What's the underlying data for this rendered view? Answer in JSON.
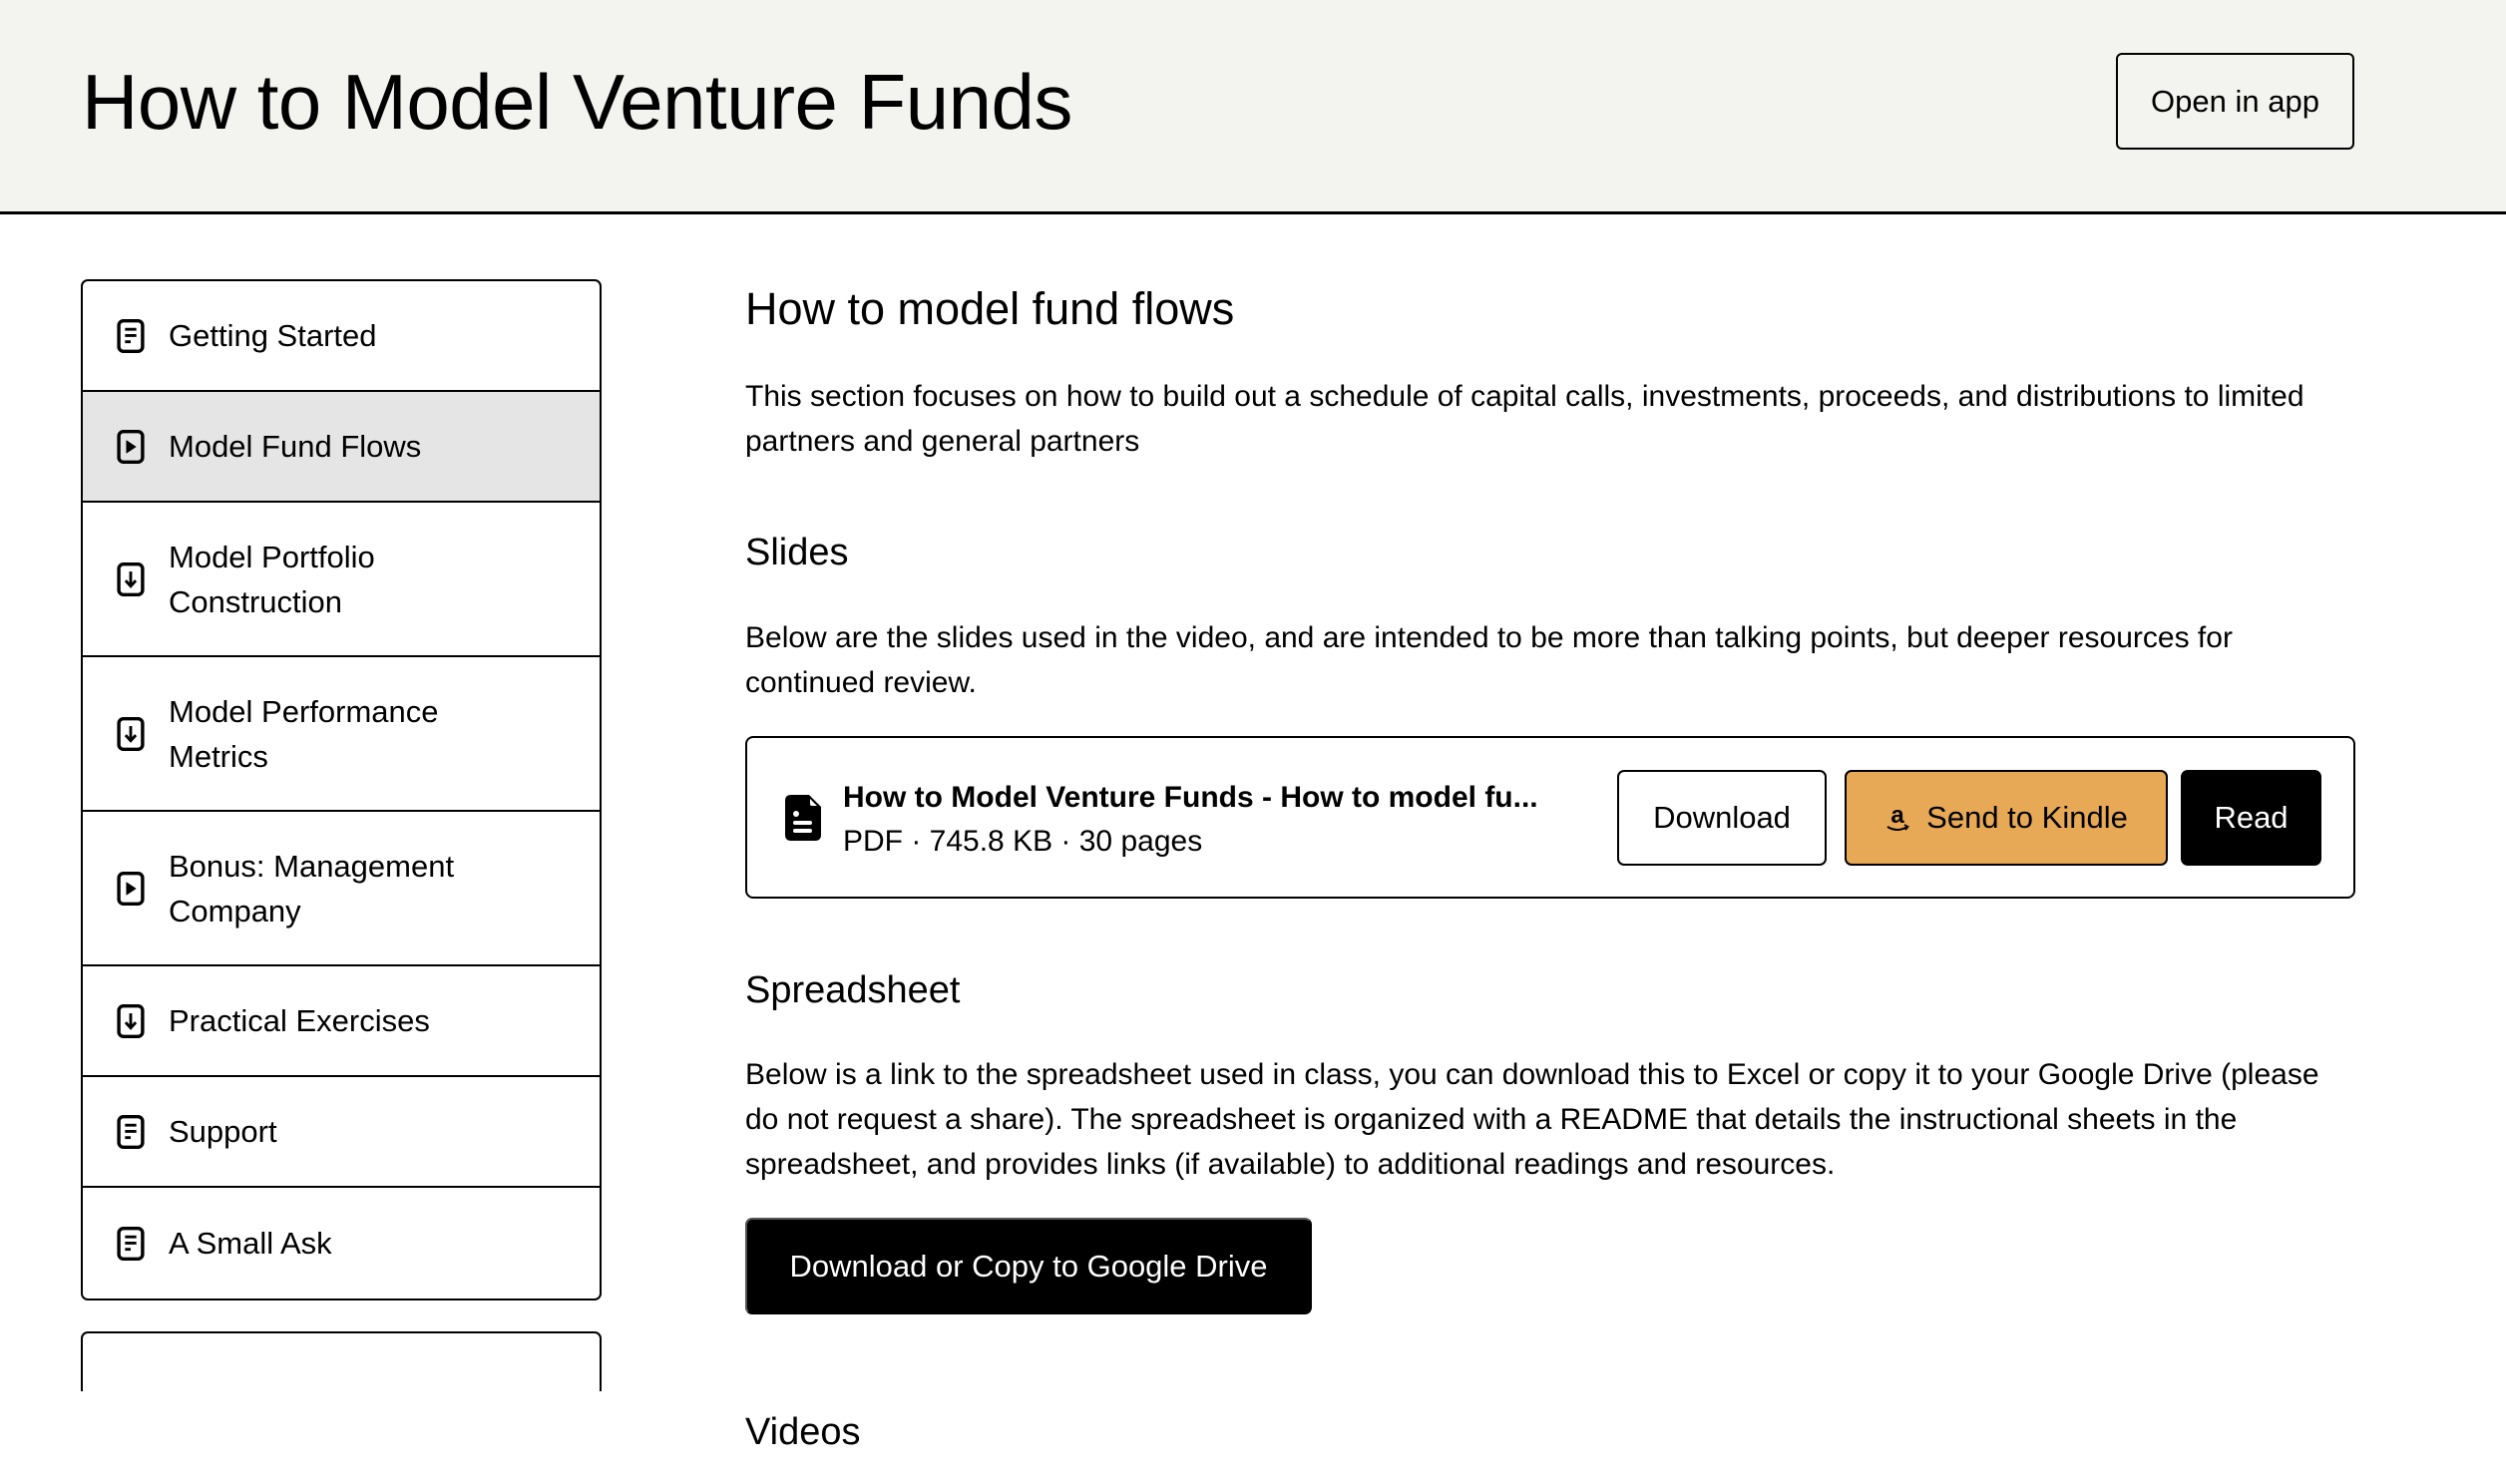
{
  "header": {
    "title": "How to Model Venture Funds",
    "open_app_label": "Open in app"
  },
  "sidebar": {
    "items": [
      {
        "label": "Getting Started",
        "icon": "document-icon",
        "active": false
      },
      {
        "label": "Model Fund Flows",
        "icon": "play-icon",
        "active": true
      },
      {
        "label": "Model Portfolio Construction",
        "icon": "download-icon",
        "active": false
      },
      {
        "label": "Model Performance Metrics",
        "icon": "download-icon",
        "active": false
      },
      {
        "label": "Bonus: Management Company",
        "icon": "play-icon",
        "active": false
      },
      {
        "label": "Practical Exercises",
        "icon": "download-icon",
        "active": false
      },
      {
        "label": "Support",
        "icon": "document-icon",
        "active": false
      },
      {
        "label": "A Small Ask",
        "icon": "document-icon",
        "active": false
      }
    ]
  },
  "main": {
    "title": "How to model fund flows",
    "intro": "This section focuses on how to build out a schedule of capital calls, investments, proceeds, and distributions to limited partners and general partners",
    "slides": {
      "heading": "Slides",
      "description": "Below are the slides used in the video, and are intended to be more than talking points, but deeper resources for continued review.",
      "file": {
        "name": "How to Model Venture Funds - How to model fu...",
        "meta": "PDF · 745.8 KB · 30 pages",
        "icon": "file-icon"
      },
      "download_label": "Download",
      "kindle_label": "Send to Kindle",
      "kindle_icon": "amazon-icon",
      "read_label": "Read",
      "kindle_color": "#e7a955"
    },
    "spreadsheet": {
      "heading": "Spreadsheet",
      "description": "Below is a link to the spreadsheet used in class, you can download this to Excel or copy it to your Google Drive (please do not request a share). The spreadsheet is organized with a README that details the instructional sheets in the spreadsheet, and provides links (if available) to additional readings and resources.",
      "button_label": "Download or Copy to Google Drive"
    },
    "videos": {
      "heading": "Videos"
    }
  }
}
